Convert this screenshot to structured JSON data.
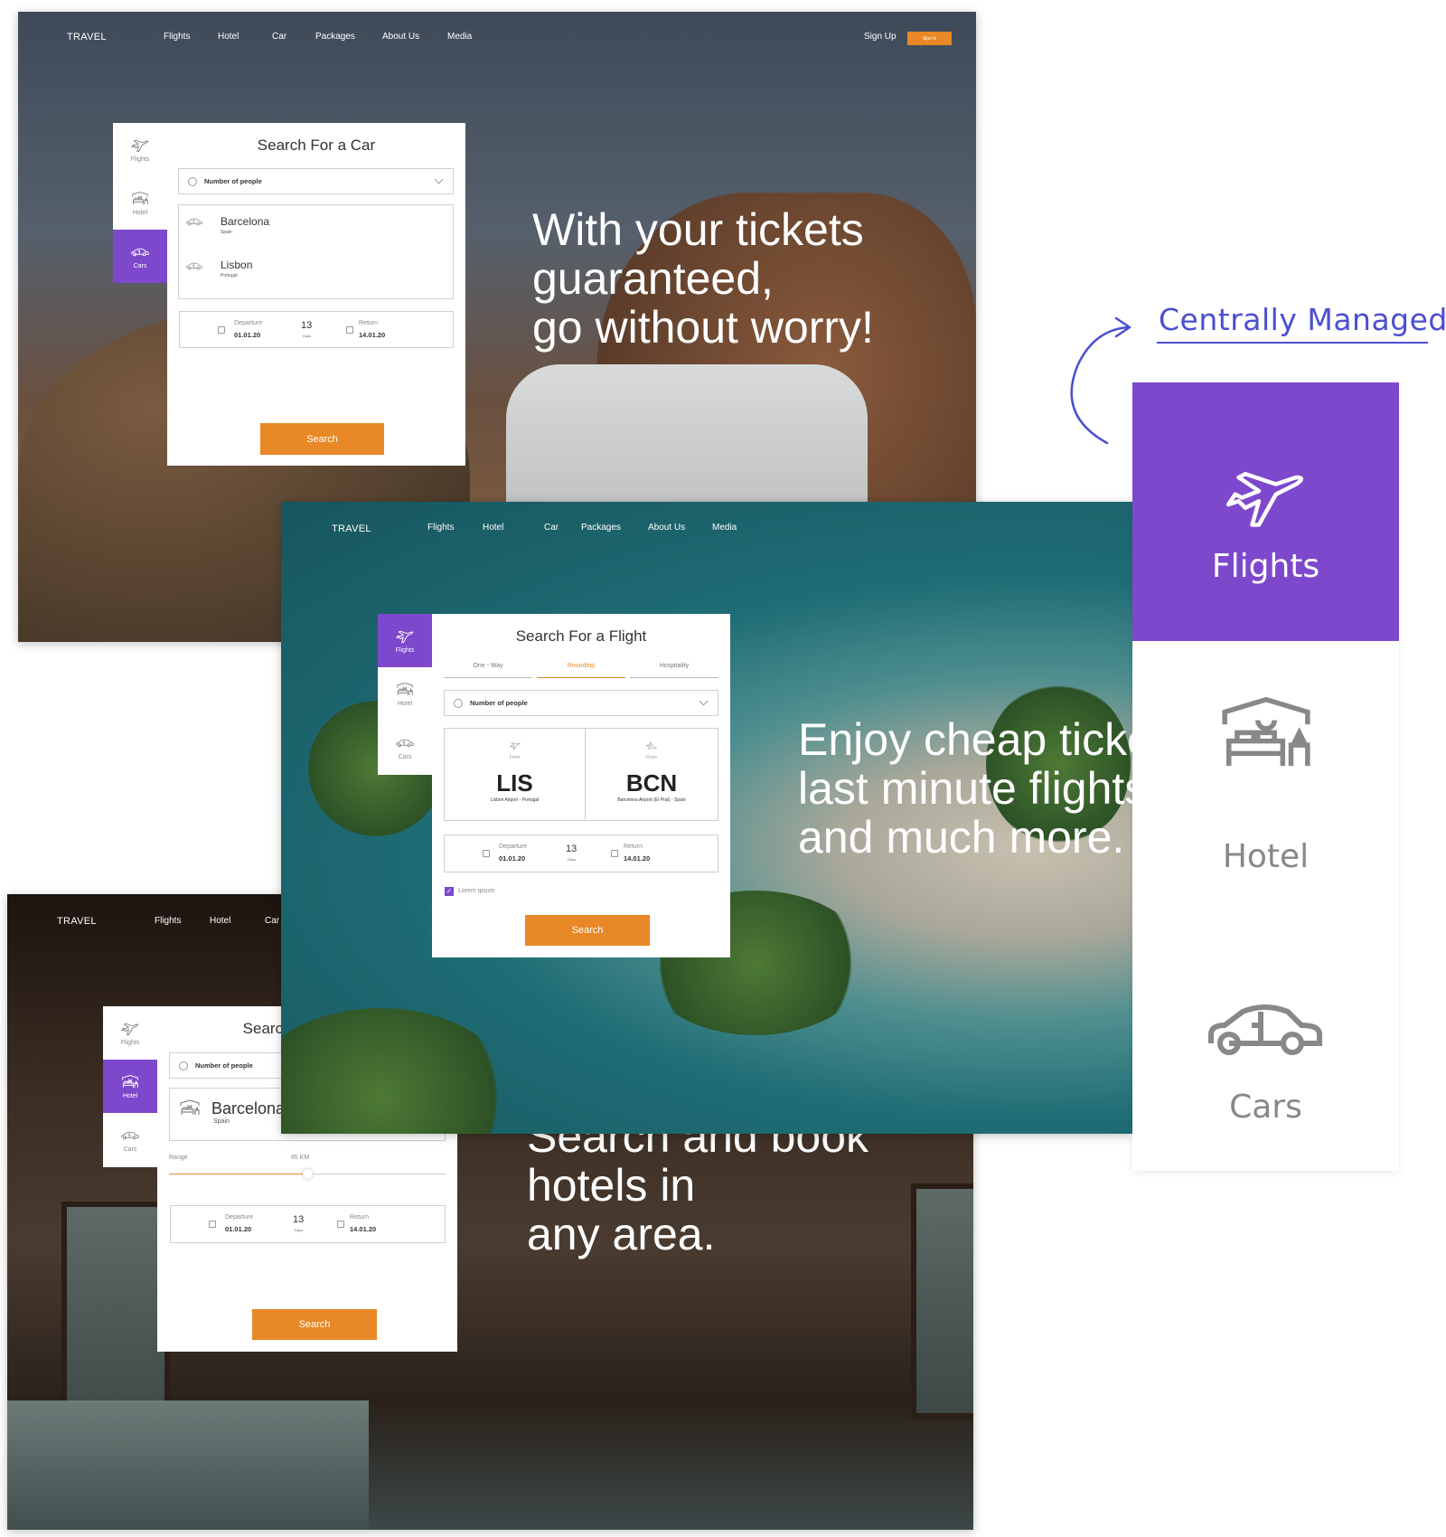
{
  "colors": {
    "accent_purple": "#7e48cc",
    "button_orange": "#e88826",
    "annotation_blue": "#4b4fd0"
  },
  "car_frame": {
    "brand": "TRAVEL",
    "nav": [
      "Flights",
      "Hotel",
      "Car",
      "Packages",
      "About Us",
      "Media"
    ],
    "sign_up": "Sign Up",
    "sign_in": "Sign In",
    "sidebar": [
      {
        "label": "Flights",
        "icon": "plane-icon"
      },
      {
        "label": "Hotel",
        "icon": "hotel-icon"
      },
      {
        "label": "Cars",
        "icon": "car-icon",
        "active": true
      }
    ],
    "title": "Search For a Car",
    "people_placeholder": "Number of people",
    "locations": [
      {
        "city": "Barcelona",
        "country": "Spain"
      },
      {
        "city": "Lisbon",
        "country": "Portugal"
      }
    ],
    "dates": {
      "departure_label": "Departure",
      "departure": "01.01.20",
      "days": "13",
      "days_label": "Days",
      "return_label": "Return",
      "return": "14.01.20"
    },
    "search": "Search",
    "headline": [
      "With your tickets",
      "guaranteed,",
      "go without worry!"
    ]
  },
  "flight_frame": {
    "brand": "TRAVEL",
    "nav": [
      "Flights",
      "Hotel",
      "Car",
      "Packages",
      "About Us",
      "Media"
    ],
    "sidebar": [
      {
        "label": "Flights",
        "icon": "plane-icon",
        "active": true
      },
      {
        "label": "Hotel",
        "icon": "hotel-icon"
      },
      {
        "label": "Cars",
        "icon": "car-icon"
      }
    ],
    "title": "Search For a Flight",
    "tabs": [
      {
        "label": "One - Way"
      },
      {
        "label": "Roundtrip",
        "active": true
      },
      {
        "label": "Hospitality"
      }
    ],
    "people_placeholder": "Number of people",
    "from": {
      "label": "From",
      "code": "LIS",
      "airport": "Lisbon Airport - Portugal"
    },
    "to": {
      "label": "From",
      "code": "BCN",
      "airport": "Barcelona Airport (El Prat) - Spain"
    },
    "dates": {
      "departure_label": "Departure",
      "departure": "01.01.20",
      "days": "13",
      "days_label": "Days",
      "return_label": "Return",
      "return": "14.01.20"
    },
    "checkbox": {
      "label": "Lorem ipsum",
      "checked": true
    },
    "search": "Search",
    "headline": [
      "Enjoy cheap tickets,",
      "last minute flights",
      "and much more."
    ]
  },
  "hotel_frame": {
    "brand": "TRAVEL",
    "nav": [
      "Flights",
      "Hotel",
      "Car"
    ],
    "sidebar": [
      {
        "label": "Flights",
        "icon": "plane-icon"
      },
      {
        "label": "Hotel",
        "icon": "hotel-icon",
        "active": true
      },
      {
        "label": "Cars",
        "icon": "car-icon"
      }
    ],
    "title": "Search For a Hotel",
    "people_placeholder": "Number of people",
    "location": {
      "city": "Barcelona",
      "country": "Spain"
    },
    "range": {
      "label": "Range",
      "value": "85 KM",
      "percent": 50
    },
    "dates": {
      "departure_label": "Departure",
      "departure": "01.01.20",
      "days": "13",
      "days_label": "Days",
      "return_label": "Return",
      "return": "14.01.20"
    },
    "search": "Search",
    "headline": [
      "Search and book",
      "hotels in",
      "any area."
    ]
  },
  "annotation": {
    "label": "Centrally Managed"
  },
  "category_panel": [
    {
      "label": "Flights",
      "icon": "plane-icon",
      "active": true
    },
    {
      "label": "Hotel",
      "icon": "hotel-icon"
    },
    {
      "label": "Cars",
      "icon": "car-icon"
    }
  ]
}
